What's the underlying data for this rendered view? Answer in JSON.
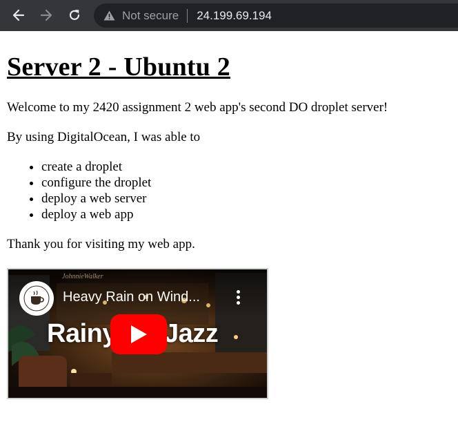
{
  "browser": {
    "security_label": "Not secure",
    "url": "24.199.69.194",
    "icons": {
      "back": "back-arrow-icon",
      "forward": "forward-arrow-icon",
      "reload": "reload-icon",
      "security": "warning-triangle-icon"
    }
  },
  "page": {
    "heading": "Server 2 - Ubuntu 2",
    "welcome": "Welcome to my 2420 assignment 2 web app's second DO droplet server!",
    "intro": "By using DigitalOcean, I was able to",
    "items": [
      "create a droplet",
      "configure the droplet",
      "deploy a web server",
      "deploy a web app"
    ],
    "thanks": "Thank you for visiting my web app."
  },
  "video": {
    "title": "Heavy Rain on Wind...",
    "overlay_left": "Rainy",
    "overlay_right": "Jazz",
    "brand": "JohnnieWalker",
    "colors": {
      "play_button": "#ff0000",
      "chrome_bg": "#35363a",
      "omnibox_bg": "#202124"
    }
  }
}
